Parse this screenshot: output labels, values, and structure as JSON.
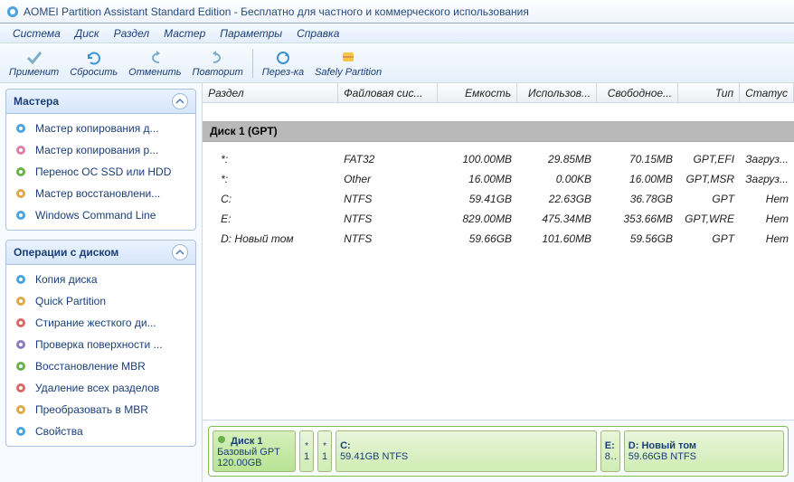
{
  "title": "AOMEI Partition Assistant Standard Edition - Бесплатно для частного и коммерческого использования",
  "menu": [
    "Система",
    "Диск",
    "Раздел",
    "Мастер",
    "Параметры",
    "Справка"
  ],
  "tools": [
    {
      "label": "Применит"
    },
    {
      "label": "Сбросить"
    },
    {
      "label": "Отменить"
    },
    {
      "label": "Повторит"
    },
    {
      "label": "Перез-ка"
    },
    {
      "label": "Safely Partition"
    }
  ],
  "panels": {
    "wizards": {
      "title": "Мастера",
      "items": [
        "Мастер копирования д...",
        "Мастер копирования р...",
        "Перенос OC SSD или HDD",
        "Мастер восстановлени...",
        "Windows Command Line"
      ]
    },
    "diskops": {
      "title": "Операции с диском",
      "items": [
        "Копия диска",
        "Quick Partition",
        "Стирание жесткого ди...",
        "Проверка поверхности ...",
        "Восстановление MBR",
        "Удаление всех разделов",
        "Преобразовать в MBR",
        "Свойства"
      ]
    }
  },
  "columns": [
    "Раздел",
    "Файловая сис...",
    "Емкость",
    "Использов...",
    "Свободное...",
    "Тип",
    "Статус"
  ],
  "disk_header": "Диск 1 (GPT)",
  "partitions": [
    {
      "name": "*:",
      "fs": "FAT32",
      "cap": "100.00MB",
      "used": "29.85MB",
      "free": "70.15MB",
      "type": "GPT,EFI",
      "status": "Загруз..."
    },
    {
      "name": "*:",
      "fs": "Other",
      "cap": "16.00MB",
      "used": "0.00KB",
      "free": "16.00MB",
      "type": "GPT,MSR",
      "status": "Загруз..."
    },
    {
      "name": "C:",
      "fs": "NTFS",
      "cap": "59.41GB",
      "used": "22.63GB",
      "free": "36.78GB",
      "type": "GPT",
      "status": "Нет"
    },
    {
      "name": "E:",
      "fs": "NTFS",
      "cap": "829.00MB",
      "used": "475.34MB",
      "free": "353.66MB",
      "type": "GPT,WRE",
      "status": "Нет"
    },
    {
      "name": "D: Новый том",
      "fs": "NTFS",
      "cap": "59.66GB",
      "used": "101.60MB",
      "free": "59.56GB",
      "type": "GPT",
      "status": "Нет"
    }
  ],
  "diskmap": {
    "disk": {
      "name": "Диск 1",
      "sub": "Базовый GPT",
      "size": "120.00GB"
    },
    "blocks": [
      {
        "name": "*",
        "sub": "1"
      },
      {
        "name": "*",
        "sub": "1"
      },
      {
        "name": "C:",
        "sub": "59.41GB NTFS"
      },
      {
        "name": "E:",
        "sub": "8.."
      },
      {
        "name": "D: Новый том",
        "sub": "59.66GB NTFS"
      }
    ]
  }
}
